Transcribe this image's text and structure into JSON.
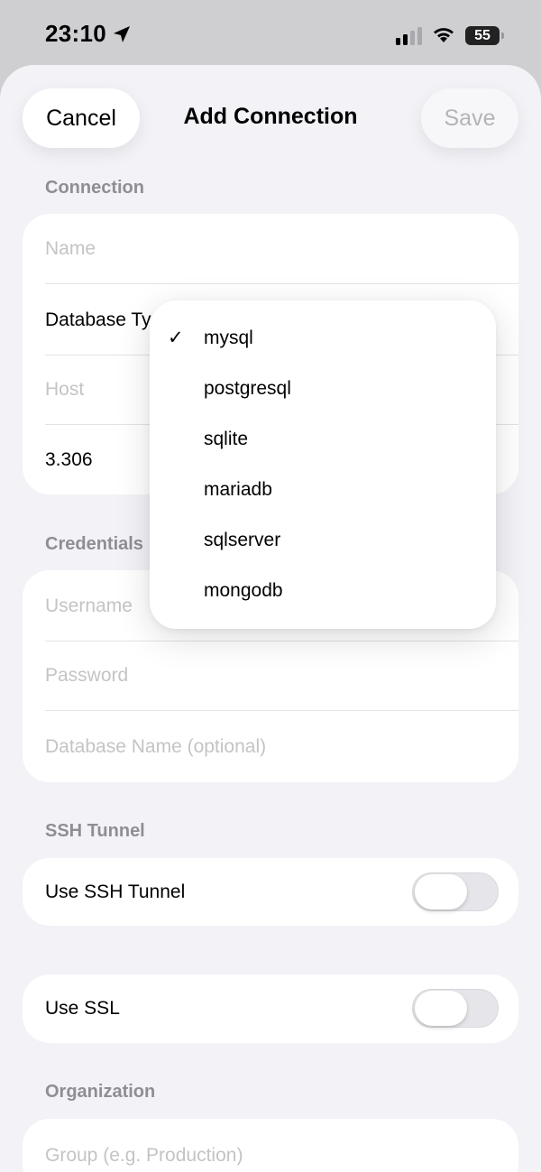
{
  "status_bar": {
    "time": "23:10",
    "battery": "55",
    "icons": [
      "location-arrow-icon",
      "cellular-signal-icon",
      "wifi-icon",
      "battery-icon"
    ]
  },
  "nav": {
    "cancel_label": "Cancel",
    "title": "Add Connection",
    "save_label": "Save"
  },
  "connection": {
    "header": "Connection",
    "name_placeholder": "Name",
    "database_type_label": "Database Ty",
    "host_placeholder": "Host",
    "port_value": "3.306"
  },
  "credentials": {
    "header": "Credentials",
    "username_placeholder": "Username",
    "password_placeholder": "Password",
    "database_name_placeholder": "Database Name (optional)"
  },
  "ssh": {
    "header": "SSH Tunnel",
    "use_ssh_label": "Use SSH Tunnel",
    "use_ssh_on": false
  },
  "ssl": {
    "use_ssl_label": "Use SSL",
    "use_ssl_on": false
  },
  "organization": {
    "header": "Organization",
    "group_placeholder": "Group (e.g. Production)"
  },
  "dropdown": {
    "selected": "mysql",
    "options": [
      "mysql",
      "postgresql",
      "sqlite",
      "mariadb",
      "sqlserver",
      "mongodb"
    ],
    "check_mark": "✓"
  },
  "colors": {
    "sheet_background": "#f2f2f7",
    "card_background": "#ffffff",
    "placeholder_text": "#c4c4c7",
    "section_header": "#8e8e93",
    "save_disabled": "#b4b4b8"
  }
}
